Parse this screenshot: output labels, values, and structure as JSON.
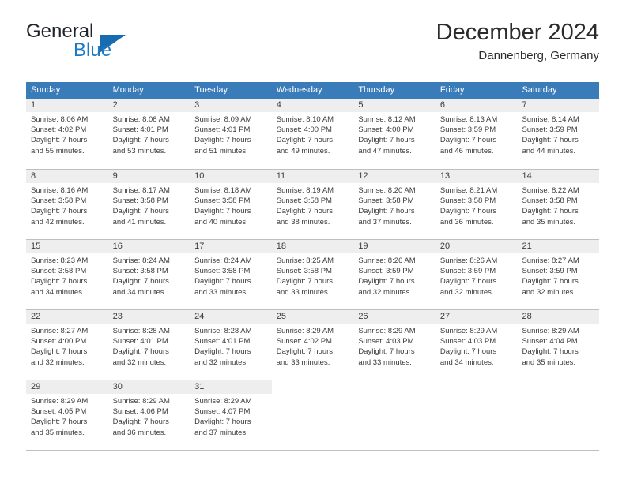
{
  "brand": {
    "name_top": "General",
    "name_bottom": "Blue",
    "color_dark": "#20242b",
    "color_blue": "#1a7ac4",
    "triangle_icon": "triangle-icon"
  },
  "header": {
    "title": "December 2024",
    "subtitle": "Dannenberg, Germany"
  },
  "theme": {
    "header_bg": "#3a7cb9",
    "header_text": "#ffffff",
    "daynum_bg": "#eeeeee",
    "grid_line": "#bfbfbf",
    "body_text": "#3b3b3b"
  },
  "calendar": {
    "weekdays": [
      "Sunday",
      "Monday",
      "Tuesday",
      "Wednesday",
      "Thursday",
      "Friday",
      "Saturday"
    ],
    "weeks": [
      [
        {
          "day": "1",
          "sunrise": "Sunrise: 8:06 AM",
          "sunset": "Sunset: 4:02 PM",
          "daylight_1": "Daylight: 7 hours",
          "daylight_2": "and 55 minutes."
        },
        {
          "day": "2",
          "sunrise": "Sunrise: 8:08 AM",
          "sunset": "Sunset: 4:01 PM",
          "daylight_1": "Daylight: 7 hours",
          "daylight_2": "and 53 minutes."
        },
        {
          "day": "3",
          "sunrise": "Sunrise: 8:09 AM",
          "sunset": "Sunset: 4:01 PM",
          "daylight_1": "Daylight: 7 hours",
          "daylight_2": "and 51 minutes."
        },
        {
          "day": "4",
          "sunrise": "Sunrise: 8:10 AM",
          "sunset": "Sunset: 4:00 PM",
          "daylight_1": "Daylight: 7 hours",
          "daylight_2": "and 49 minutes."
        },
        {
          "day": "5",
          "sunrise": "Sunrise: 8:12 AM",
          "sunset": "Sunset: 4:00 PM",
          "daylight_1": "Daylight: 7 hours",
          "daylight_2": "and 47 minutes."
        },
        {
          "day": "6",
          "sunrise": "Sunrise: 8:13 AM",
          "sunset": "Sunset: 3:59 PM",
          "daylight_1": "Daylight: 7 hours",
          "daylight_2": "and 46 minutes."
        },
        {
          "day": "7",
          "sunrise": "Sunrise: 8:14 AM",
          "sunset": "Sunset: 3:59 PM",
          "daylight_1": "Daylight: 7 hours",
          "daylight_2": "and 44 minutes."
        }
      ],
      [
        {
          "day": "8",
          "sunrise": "Sunrise: 8:16 AM",
          "sunset": "Sunset: 3:58 PM",
          "daylight_1": "Daylight: 7 hours",
          "daylight_2": "and 42 minutes."
        },
        {
          "day": "9",
          "sunrise": "Sunrise: 8:17 AM",
          "sunset": "Sunset: 3:58 PM",
          "daylight_1": "Daylight: 7 hours",
          "daylight_2": "and 41 minutes."
        },
        {
          "day": "10",
          "sunrise": "Sunrise: 8:18 AM",
          "sunset": "Sunset: 3:58 PM",
          "daylight_1": "Daylight: 7 hours",
          "daylight_2": "and 40 minutes."
        },
        {
          "day": "11",
          "sunrise": "Sunrise: 8:19 AM",
          "sunset": "Sunset: 3:58 PM",
          "daylight_1": "Daylight: 7 hours",
          "daylight_2": "and 38 minutes."
        },
        {
          "day": "12",
          "sunrise": "Sunrise: 8:20 AM",
          "sunset": "Sunset: 3:58 PM",
          "daylight_1": "Daylight: 7 hours",
          "daylight_2": "and 37 minutes."
        },
        {
          "day": "13",
          "sunrise": "Sunrise: 8:21 AM",
          "sunset": "Sunset: 3:58 PM",
          "daylight_1": "Daylight: 7 hours",
          "daylight_2": "and 36 minutes."
        },
        {
          "day": "14",
          "sunrise": "Sunrise: 8:22 AM",
          "sunset": "Sunset: 3:58 PM",
          "daylight_1": "Daylight: 7 hours",
          "daylight_2": "and 35 minutes."
        }
      ],
      [
        {
          "day": "15",
          "sunrise": "Sunrise: 8:23 AM",
          "sunset": "Sunset: 3:58 PM",
          "daylight_1": "Daylight: 7 hours",
          "daylight_2": "and 34 minutes."
        },
        {
          "day": "16",
          "sunrise": "Sunrise: 8:24 AM",
          "sunset": "Sunset: 3:58 PM",
          "daylight_1": "Daylight: 7 hours",
          "daylight_2": "and 34 minutes."
        },
        {
          "day": "17",
          "sunrise": "Sunrise: 8:24 AM",
          "sunset": "Sunset: 3:58 PM",
          "daylight_1": "Daylight: 7 hours",
          "daylight_2": "and 33 minutes."
        },
        {
          "day": "18",
          "sunrise": "Sunrise: 8:25 AM",
          "sunset": "Sunset: 3:58 PM",
          "daylight_1": "Daylight: 7 hours",
          "daylight_2": "and 33 minutes."
        },
        {
          "day": "19",
          "sunrise": "Sunrise: 8:26 AM",
          "sunset": "Sunset: 3:59 PM",
          "daylight_1": "Daylight: 7 hours",
          "daylight_2": "and 32 minutes."
        },
        {
          "day": "20",
          "sunrise": "Sunrise: 8:26 AM",
          "sunset": "Sunset: 3:59 PM",
          "daylight_1": "Daylight: 7 hours",
          "daylight_2": "and 32 minutes."
        },
        {
          "day": "21",
          "sunrise": "Sunrise: 8:27 AM",
          "sunset": "Sunset: 3:59 PM",
          "daylight_1": "Daylight: 7 hours",
          "daylight_2": "and 32 minutes."
        }
      ],
      [
        {
          "day": "22",
          "sunrise": "Sunrise: 8:27 AM",
          "sunset": "Sunset: 4:00 PM",
          "daylight_1": "Daylight: 7 hours",
          "daylight_2": "and 32 minutes."
        },
        {
          "day": "23",
          "sunrise": "Sunrise: 8:28 AM",
          "sunset": "Sunset: 4:01 PM",
          "daylight_1": "Daylight: 7 hours",
          "daylight_2": "and 32 minutes."
        },
        {
          "day": "24",
          "sunrise": "Sunrise: 8:28 AM",
          "sunset": "Sunset: 4:01 PM",
          "daylight_1": "Daylight: 7 hours",
          "daylight_2": "and 32 minutes."
        },
        {
          "day": "25",
          "sunrise": "Sunrise: 8:29 AM",
          "sunset": "Sunset: 4:02 PM",
          "daylight_1": "Daylight: 7 hours",
          "daylight_2": "and 33 minutes."
        },
        {
          "day": "26",
          "sunrise": "Sunrise: 8:29 AM",
          "sunset": "Sunset: 4:03 PM",
          "daylight_1": "Daylight: 7 hours",
          "daylight_2": "and 33 minutes."
        },
        {
          "day": "27",
          "sunrise": "Sunrise: 8:29 AM",
          "sunset": "Sunset: 4:03 PM",
          "daylight_1": "Daylight: 7 hours",
          "daylight_2": "and 34 minutes."
        },
        {
          "day": "28",
          "sunrise": "Sunrise: 8:29 AM",
          "sunset": "Sunset: 4:04 PM",
          "daylight_1": "Daylight: 7 hours",
          "daylight_2": "and 35 minutes."
        }
      ],
      [
        {
          "day": "29",
          "sunrise": "Sunrise: 8:29 AM",
          "sunset": "Sunset: 4:05 PM",
          "daylight_1": "Daylight: 7 hours",
          "daylight_2": "and 35 minutes."
        },
        {
          "day": "30",
          "sunrise": "Sunrise: 8:29 AM",
          "sunset": "Sunset: 4:06 PM",
          "daylight_1": "Daylight: 7 hours",
          "daylight_2": "and 36 minutes."
        },
        {
          "day": "31",
          "sunrise": "Sunrise: 8:29 AM",
          "sunset": "Sunset: 4:07 PM",
          "daylight_1": "Daylight: 7 hours",
          "daylight_2": "and 37 minutes."
        },
        {
          "day": "",
          "sunrise": "",
          "sunset": "",
          "daylight_1": "",
          "daylight_2": ""
        },
        {
          "day": "",
          "sunrise": "",
          "sunset": "",
          "daylight_1": "",
          "daylight_2": ""
        },
        {
          "day": "",
          "sunrise": "",
          "sunset": "",
          "daylight_1": "",
          "daylight_2": ""
        },
        {
          "day": "",
          "sunrise": "",
          "sunset": "",
          "daylight_1": "",
          "daylight_2": ""
        }
      ]
    ]
  }
}
